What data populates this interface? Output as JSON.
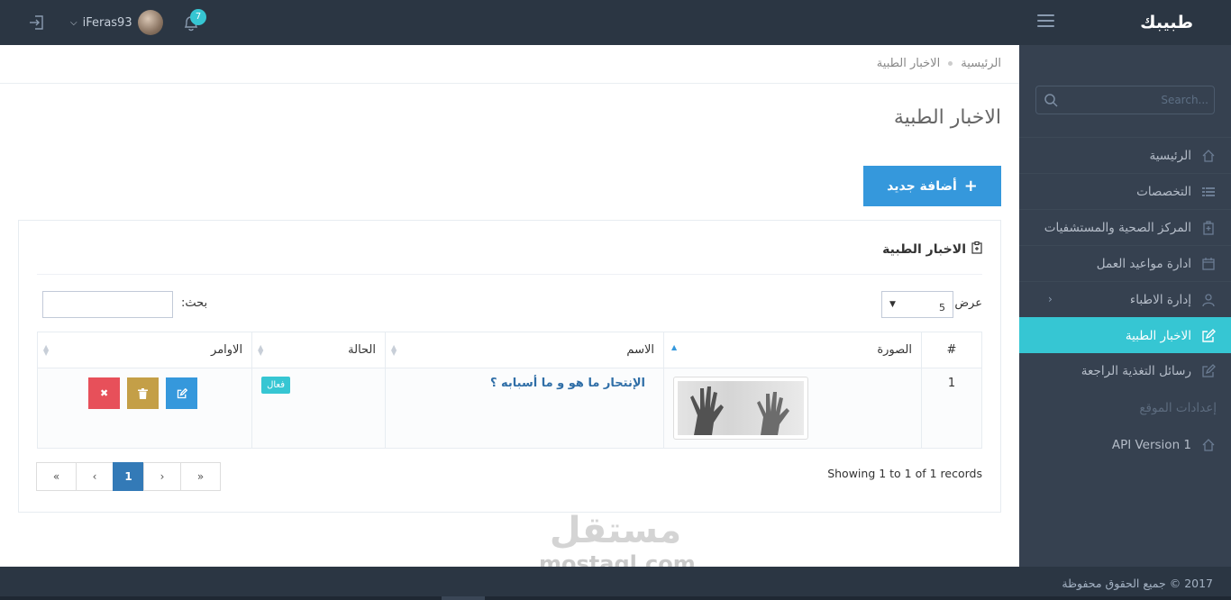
{
  "app": {
    "brand": "طبيبك"
  },
  "topbar": {
    "username": "iFeras93",
    "notification_count": "7"
  },
  "sidebar": {
    "search_placeholder": "Search...",
    "items": [
      {
        "label": "الرئيسية",
        "icon": "home-icon"
      },
      {
        "label": "التخصصات",
        "icon": "list-icon"
      },
      {
        "label": "المركز الصحية والمستشفيات",
        "icon": "hospital-icon"
      },
      {
        "label": "ادارة مواعيد العمل",
        "icon": "calendar-icon"
      },
      {
        "label": "إدارة الاطباء",
        "icon": "doctors-icon"
      },
      {
        "label": "الاخبار الطبية",
        "icon": "edit-icon",
        "active": true
      },
      {
        "label": "رسائل التغذية الراجعة",
        "icon": "edit-icon"
      }
    ],
    "section_heading": "إعدادات الموقع",
    "api_item": "API Version 1"
  },
  "breadcrumb": {
    "home": "الرئيسية",
    "current": "الاخبار الطبية"
  },
  "page": {
    "title": "الاخبار الطبية",
    "add_button": "أضافة جديد"
  },
  "portlet": {
    "title": "الاخبار الطبية",
    "length_label": "عرض",
    "length_value": "5",
    "search_label": "بحث:",
    "columns": [
      "#",
      "الصورة",
      "الاسم",
      "الحالة",
      "الاوامر"
    ],
    "rows": [
      {
        "num": "1",
        "name": "الإنتحار ما هو و ما أسبابه ؟",
        "status": "فعال"
      }
    ],
    "showing": "Showing 1 to 1 of 1 records",
    "pager": [
      "«",
      "‹",
      "1",
      "›",
      "»"
    ]
  },
  "watermark": {
    "ar": "مستقل",
    "en": "mostaql.com"
  },
  "footer": {
    "text": "2017 © جميع الحقوق محفوظة"
  },
  "colors": {
    "accent": "#36c6d3",
    "primary": "#3598dc",
    "topbar": "#2b3643",
    "sidebar": "#364150",
    "danger": "#e7505a",
    "warning": "#c49f47"
  }
}
